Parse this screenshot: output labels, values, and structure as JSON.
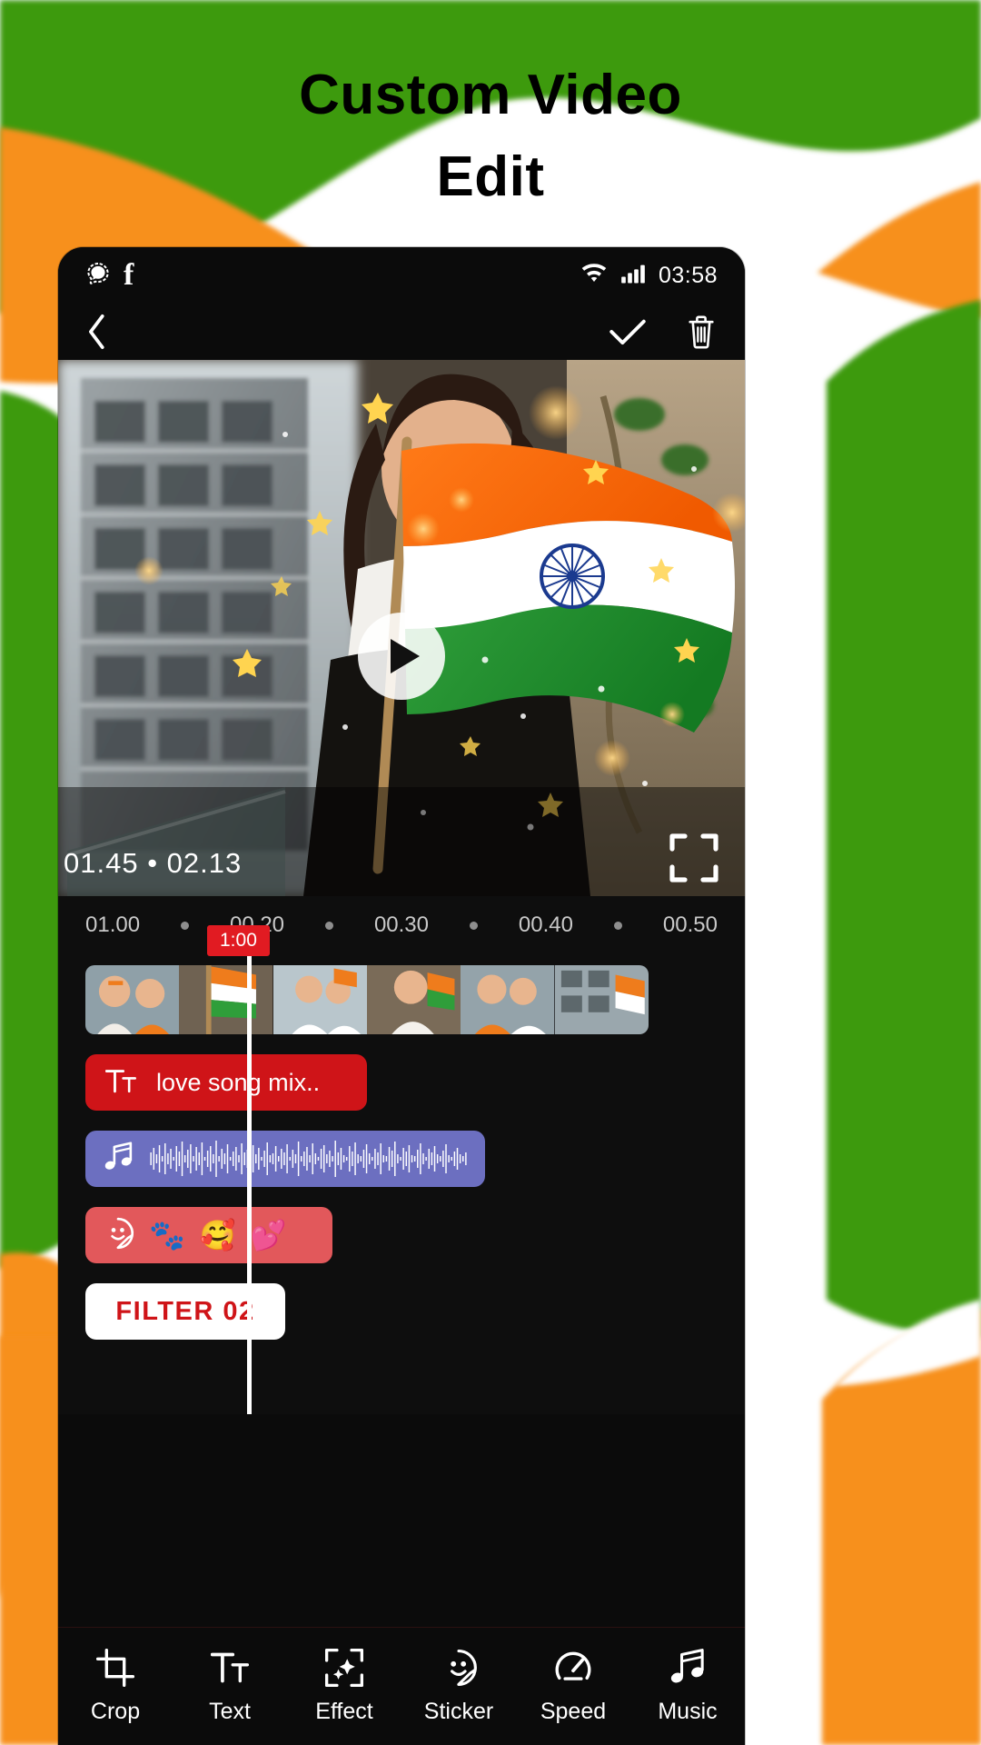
{
  "heading": {
    "line1": "Custom Video",
    "line2": "Edit"
  },
  "colors": {
    "saffron": "#F7901E",
    "green": "#3C9A09",
    "white": "#FFFFFF",
    "accent_red": "#CF1418",
    "audio_purple": "#6C6FC0",
    "sticker_red": "#E2585B",
    "playhead_badge": "#E11B22",
    "screen_bg": "#0B0B0B"
  },
  "statusbar": {
    "left_icons": [
      "signal-messenger-icon",
      "facebook-icon"
    ],
    "right_icons": [
      "wifi-icon",
      "cellular-signal-icon"
    ],
    "time": "03:58"
  },
  "toolbar": {
    "back_icon": "chevron-left-icon",
    "confirm_icon": "check-icon",
    "delete_icon": "trash-icon"
  },
  "preview": {
    "play_icon": "play-icon",
    "timecode": "01.45 • 02.13",
    "fullscreen_icon": "fullscreen-icon"
  },
  "timeline": {
    "ruler": [
      {
        "type": "label",
        "text": "01.00"
      },
      {
        "type": "dot"
      },
      {
        "type": "label",
        "text": "00.20"
      },
      {
        "type": "dot"
      },
      {
        "type": "label",
        "text": "00.30"
      },
      {
        "type": "dot"
      },
      {
        "type": "label",
        "text": "00.40"
      },
      {
        "type": "dot"
      },
      {
        "type": "label",
        "text": "00.50"
      }
    ],
    "playhead_badge": "1:00",
    "text_track": {
      "icon": "text-format-icon",
      "label": "love song mix.."
    },
    "audio_track": {
      "icon": "music-note-icon"
    },
    "sticker_track": {
      "icon": "sticker-face-icon",
      "stickers": [
        "🐾",
        "🥰",
        "💕"
      ]
    },
    "filter_track": {
      "label": "FILTER  02"
    }
  },
  "bottom_tools": [
    {
      "icon": "crop-icon",
      "label": "Crop"
    },
    {
      "icon": "text-icon",
      "label": "Text"
    },
    {
      "icon": "effect-icon",
      "label": "Effect"
    },
    {
      "icon": "sticker-icon",
      "label": "Sticker"
    },
    {
      "icon": "speed-icon",
      "label": "Speed"
    },
    {
      "icon": "music-icon",
      "label": "Music"
    }
  ]
}
